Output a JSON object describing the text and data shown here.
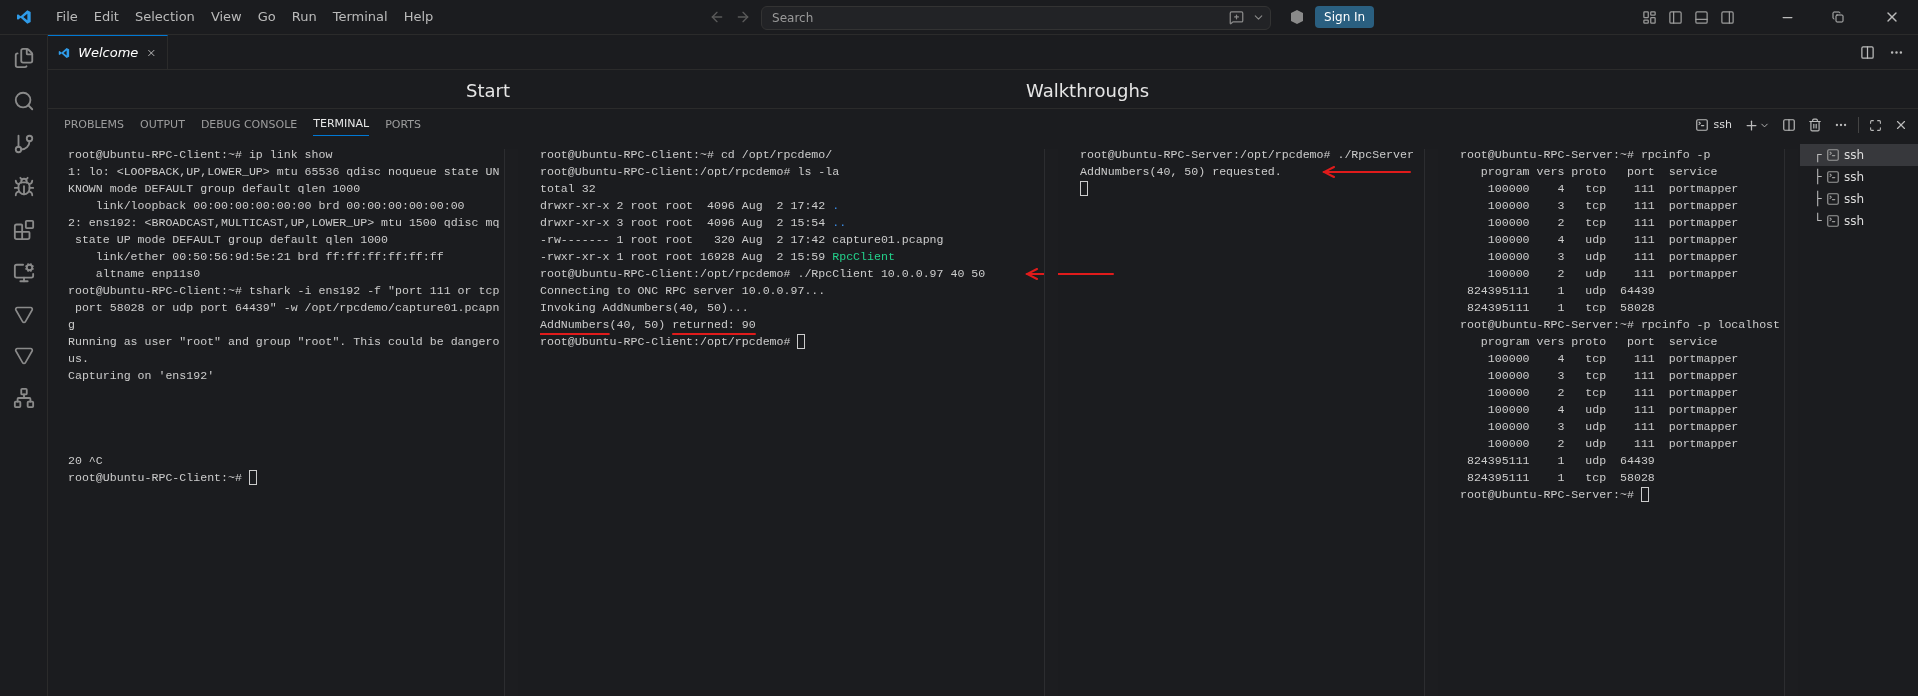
{
  "menu": [
    "File",
    "Edit",
    "Selection",
    "View",
    "Go",
    "Run",
    "Terminal",
    "Help"
  ],
  "search": {
    "placeholder": "Search"
  },
  "sign_in": "Sign In",
  "editor_tabs": [
    {
      "label": "Welcome",
      "selected": true
    }
  ],
  "welcome": {
    "headings": [
      "Start",
      "Walkthroughs"
    ]
  },
  "panel_tabs": [
    {
      "label": "PROBLEMS",
      "selected": false
    },
    {
      "label": "OUTPUT",
      "selected": false
    },
    {
      "label": "DEBUG CONSOLE",
      "selected": false
    },
    {
      "label": "TERMINAL",
      "selected": true
    },
    {
      "label": "PORTS",
      "selected": false
    }
  ],
  "terminal_profile": "ssh",
  "panes": [
    {
      "lines": [
        {
          "text": "root@Ubuntu-RPC-Client:~# ip link show"
        },
        {
          "text": "1: lo: <LOOPBACK,UP,LOWER_UP> mtu 65536 qdisc noqueue state UN"
        },
        {
          "text": "KNOWN mode DEFAULT group default qlen 1000"
        },
        {
          "text": "    link/loopback 00:00:00:00:00:00 brd 00:00:00:00:00:00"
        },
        {
          "text": "2: ens192: <BROADCAST,MULTICAST,UP,LOWER_UP> mtu 1500 qdisc mq"
        },
        {
          "text": " state UP mode DEFAULT group default qlen 1000"
        },
        {
          "text": "    link/ether 00:50:56:9d:5e:21 brd ff:ff:ff:ff:ff:ff"
        },
        {
          "text": "    altname enp11s0"
        },
        {
          "text": "root@Ubuntu-RPC-Client:~# tshark -i ens192 -f \"port 111 or tcp"
        },
        {
          "text": " port 58028 or udp port 64439\" -w /opt/rpcdemo/capture01.pcapn"
        },
        {
          "text": "g"
        },
        {
          "text": "Running as user \"root\" and group \"root\". This could be dangero"
        },
        {
          "text": "us."
        },
        {
          "text": "Capturing on 'ens192'"
        },
        {
          "kind": "blank"
        },
        {
          "kind": "blank"
        },
        {
          "kind": "blank"
        },
        {
          "kind": "blank"
        },
        {
          "text": "20 ^C"
        },
        {
          "text": "root@Ubuntu-RPC-Client:~# ",
          "cursor": true
        }
      ]
    },
    {
      "lines": [
        {
          "text": "root@Ubuntu-RPC-Client:~# cd /opt/rpcdemo/"
        },
        {
          "text": "root@Ubuntu-RPC-Client:/opt/rpcdemo# ls -la"
        },
        {
          "text": "total 32"
        },
        {
          "segments": [
            {
              "text": "drwxr-xr-x 2 root root  4096 Aug  2 17:42 "
            },
            {
              "text": ".",
              "kind": "dir"
            }
          ]
        },
        {
          "segments": [
            {
              "text": "drwxr-xr-x 3 root root  4096 Aug  2 15:54 "
            },
            {
              "text": "..",
              "kind": "dir"
            }
          ]
        },
        {
          "text": "-rw------- 1 root root   320 Aug  2 17:42 capture01.pcapng"
        },
        {
          "segments": [
            {
              "text": "-rwxr-xr-x 1 root root 16928 Aug  2 15:59 "
            },
            {
              "text": "RpcClient",
              "kind": "exec"
            }
          ]
        },
        {
          "text": "root@Ubuntu-RPC-Client:/opt/rpcdemo# ./RpcClient 10.0.0.97 40 50",
          "arrow": true
        },
        {
          "text": "Connecting to ONC RPC server 10.0.0.97..."
        },
        {
          "text": "Invoking AddNumbers(40, 50)..."
        },
        {
          "segments": [
            {
              "text": "AddNumbers",
              "kind": "underlined"
            },
            {
              "text": "(40, 50) "
            },
            {
              "text": "returned: 90",
              "kind": "underlined"
            }
          ]
        },
        {
          "text": "root@Ubuntu-RPC-Client:/opt/rpcdemo# ",
          "cursor": true
        }
      ]
    },
    {
      "lines": [
        {
          "text": "root@Ubuntu-RPC-Server:/opt/rpcdemo# ./RpcServer"
        },
        {
          "text": "AddNumbers(40, 50) requested.",
          "arrow": true
        },
        {
          "kind": "blank",
          "cursor": true
        }
      ]
    },
    {
      "lines": [
        {
          "text": "root@Ubuntu-RPC-Server:~# rpcinfo -p"
        },
        {
          "text": "   program vers proto   port  service"
        },
        {
          "text": "    100000    4   tcp    111  portmapper"
        },
        {
          "text": "    100000    3   tcp    111  portmapper"
        },
        {
          "text": "    100000    2   tcp    111  portmapper"
        },
        {
          "text": "    100000    4   udp    111  portmapper"
        },
        {
          "text": "    100000    3   udp    111  portmapper"
        },
        {
          "text": "    100000    2   udp    111  portmapper"
        },
        {
          "text": " 824395111    1   udp  64439"
        },
        {
          "text": " 824395111    1   tcp  58028"
        },
        {
          "text": "root@Ubuntu-RPC-Server:~# rpcinfo -p localhost"
        },
        {
          "text": "   program vers proto   port  service"
        },
        {
          "text": "    100000    4   tcp    111  portmapper"
        },
        {
          "text": "    100000    3   tcp    111  portmapper"
        },
        {
          "text": "    100000    2   tcp    111  portmapper"
        },
        {
          "text": "    100000    4   udp    111  portmapper"
        },
        {
          "text": "    100000    3   udp    111  portmapper"
        },
        {
          "text": "    100000    2   udp    111  portmapper"
        },
        {
          "text": " 824395111    1   udp  64439"
        },
        {
          "text": " 824395111    1   tcp  58028"
        },
        {
          "text": "root@Ubuntu-RPC-Server:~# ",
          "cursor": true
        }
      ]
    }
  ],
  "terminal_tabs": [
    {
      "prefix": "┌",
      "label": "ssh",
      "selected": true
    },
    {
      "prefix": "├",
      "label": "ssh",
      "selected": false
    },
    {
      "prefix": "├",
      "label": "ssh",
      "selected": false
    },
    {
      "prefix": "└",
      "label": "ssh",
      "selected": false
    }
  ]
}
